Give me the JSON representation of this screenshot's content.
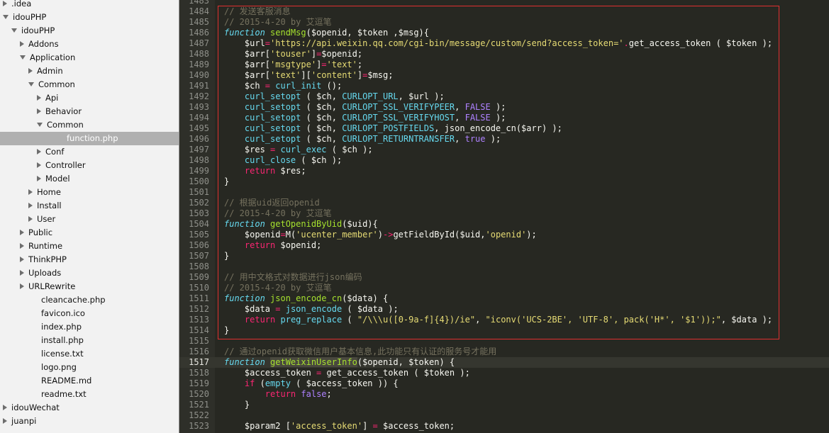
{
  "sidebar": {
    "items": [
      {
        "label": ".idea",
        "depth": 0,
        "state": "closed"
      },
      {
        "label": "idouPHP",
        "depth": 0,
        "state": "open"
      },
      {
        "label": "idouPHP",
        "depth": 1,
        "state": "open"
      },
      {
        "label": "Addons",
        "depth": 2,
        "state": "closed"
      },
      {
        "label": "Application",
        "depth": 2,
        "state": "open"
      },
      {
        "label": "Admin",
        "depth": 3,
        "state": "closed"
      },
      {
        "label": "Common",
        "depth": 3,
        "state": "open"
      },
      {
        "label": "Api",
        "depth": 4,
        "state": "closed"
      },
      {
        "label": "Behavior",
        "depth": 4,
        "state": "closed"
      },
      {
        "label": "Common",
        "depth": 4,
        "state": "open"
      },
      {
        "label": "function.php",
        "depth": 5,
        "state": "file",
        "selected": true
      },
      {
        "label": "Conf",
        "depth": 4,
        "state": "closed"
      },
      {
        "label": "Controller",
        "depth": 4,
        "state": "closed"
      },
      {
        "label": "Model",
        "depth": 4,
        "state": "closed"
      },
      {
        "label": "Home",
        "depth": 3,
        "state": "closed"
      },
      {
        "label": "Install",
        "depth": 3,
        "state": "closed"
      },
      {
        "label": "User",
        "depth": 3,
        "state": "closed"
      },
      {
        "label": "Public",
        "depth": 2,
        "state": "closed"
      },
      {
        "label": "Runtime",
        "depth": 2,
        "state": "closed"
      },
      {
        "label": "ThinkPHP",
        "depth": 2,
        "state": "closed"
      },
      {
        "label": "Uploads",
        "depth": 2,
        "state": "closed"
      },
      {
        "label": "URLRewrite",
        "depth": 2,
        "state": "closed"
      },
      {
        "label": "cleancache.php",
        "depth": 2,
        "state": "file"
      },
      {
        "label": "favicon.ico",
        "depth": 2,
        "state": "file"
      },
      {
        "label": "index.php",
        "depth": 2,
        "state": "file"
      },
      {
        "label": "install.php",
        "depth": 2,
        "state": "file"
      },
      {
        "label": "license.txt",
        "depth": 2,
        "state": "file"
      },
      {
        "label": "logo.png",
        "depth": 2,
        "state": "file"
      },
      {
        "label": "README.md",
        "depth": 2,
        "state": "file"
      },
      {
        "label": "readme.txt",
        "depth": 2,
        "state": "file"
      },
      {
        "label": "idouWechat",
        "depth": 0,
        "state": "closed"
      },
      {
        "label": "juanpi",
        "depth": 0,
        "state": "closed"
      }
    ]
  },
  "editor": {
    "current_line": 1517,
    "lines": [
      {
        "n": "1483",
        "tokens": []
      },
      {
        "n": "1484",
        "tokens": [
          [
            "c",
            "// 发送客服消息"
          ]
        ]
      },
      {
        "n": "1485",
        "tokens": [
          [
            "c",
            "// 2015-4-20 by 艾逗笔"
          ]
        ]
      },
      {
        "n": "1486",
        "tokens": [
          [
            "kw",
            "function"
          ],
          [
            "",
            " "
          ],
          [
            "f",
            "sendMsg"
          ],
          [
            "",
            "($openid, $token ,$msg){"
          ]
        ]
      },
      {
        "n": "1487",
        "tokens": [
          [
            "",
            "    $url"
          ],
          [
            "k",
            "="
          ],
          [
            "s",
            "'https://api.weixin.qq.com/cgi-bin/message/custom/send?access_token='"
          ],
          [
            "k",
            "."
          ],
          [
            "",
            "get_access_token ( $token );"
          ]
        ]
      },
      {
        "n": "1488",
        "tokens": [
          [
            "",
            "    $arr["
          ],
          [
            "s",
            "'touser'"
          ],
          [
            "",
            "]"
          ],
          [
            "k",
            "="
          ],
          [
            "",
            "$openid;"
          ]
        ]
      },
      {
        "n": "1489",
        "tokens": [
          [
            "",
            "    $arr["
          ],
          [
            "s",
            "'msgtype'"
          ],
          [
            "",
            "]"
          ],
          [
            "k",
            "="
          ],
          [
            "s",
            "'text'"
          ],
          [
            "",
            ";"
          ]
        ]
      },
      {
        "n": "1490",
        "tokens": [
          [
            "",
            "    $arr["
          ],
          [
            "s",
            "'text'"
          ],
          [
            "",
            "]["
          ],
          [
            "s",
            "'content'"
          ],
          [
            "",
            "]"
          ],
          [
            "k",
            "="
          ],
          [
            "",
            "$msg;"
          ]
        ]
      },
      {
        "n": "1491",
        "tokens": [
          [
            "",
            "    $ch "
          ],
          [
            "k",
            "="
          ],
          [
            "",
            " "
          ],
          [
            "b",
            "curl_init"
          ],
          [
            "",
            " ();"
          ]
        ]
      },
      {
        "n": "1492",
        "tokens": [
          [
            "",
            "    "
          ],
          [
            "b",
            "curl_setopt"
          ],
          [
            "",
            " ( $ch, "
          ],
          [
            "b",
            "CURLOPT_URL"
          ],
          [
            "",
            ", $url );"
          ]
        ]
      },
      {
        "n": "1493",
        "tokens": [
          [
            "",
            "    "
          ],
          [
            "b",
            "curl_setopt"
          ],
          [
            "",
            " ( $ch, "
          ],
          [
            "b",
            "CURLOPT_SSL_VERIFYPEER"
          ],
          [
            "",
            ", "
          ],
          [
            "cst",
            "FALSE"
          ],
          [
            "",
            " );"
          ]
        ]
      },
      {
        "n": "1494",
        "tokens": [
          [
            "",
            "    "
          ],
          [
            "b",
            "curl_setopt"
          ],
          [
            "",
            " ( $ch, "
          ],
          [
            "b",
            "CURLOPT_SSL_VERIFYHOST"
          ],
          [
            "",
            ", "
          ],
          [
            "cst",
            "FALSE"
          ],
          [
            "",
            " );"
          ]
        ]
      },
      {
        "n": "1495",
        "tokens": [
          [
            "",
            "    "
          ],
          [
            "b",
            "curl_setopt"
          ],
          [
            "",
            " ( $ch, "
          ],
          [
            "b",
            "CURLOPT_POSTFIELDS"
          ],
          [
            "",
            ", json_encode_cn($arr) );"
          ]
        ]
      },
      {
        "n": "1496",
        "tokens": [
          [
            "",
            "    "
          ],
          [
            "b",
            "curl_setopt"
          ],
          [
            "",
            " ( $ch, "
          ],
          [
            "b",
            "CURLOPT_RETURNTRANSFER"
          ],
          [
            "",
            ", "
          ],
          [
            "cst",
            "true"
          ],
          [
            "",
            " );"
          ]
        ]
      },
      {
        "n": "1497",
        "tokens": [
          [
            "",
            "    $res "
          ],
          [
            "k",
            "="
          ],
          [
            "",
            " "
          ],
          [
            "b",
            "curl_exec"
          ],
          [
            "",
            " ( $ch );"
          ]
        ]
      },
      {
        "n": "1498",
        "tokens": [
          [
            "",
            "    "
          ],
          [
            "b",
            "curl_close"
          ],
          [
            "",
            " ( $ch );"
          ]
        ]
      },
      {
        "n": "1499",
        "tokens": [
          [
            "",
            "    "
          ],
          [
            "k",
            "return"
          ],
          [
            "",
            " $res;"
          ]
        ]
      },
      {
        "n": "1500",
        "tokens": [
          [
            "",
            "}"
          ]
        ]
      },
      {
        "n": "1501",
        "tokens": []
      },
      {
        "n": "1502",
        "tokens": [
          [
            "c",
            "// 根据uid返回openid"
          ]
        ]
      },
      {
        "n": "1503",
        "tokens": [
          [
            "c",
            "// 2015-4-20 by 艾逗笔"
          ]
        ]
      },
      {
        "n": "1504",
        "tokens": [
          [
            "kw",
            "function"
          ],
          [
            "",
            " "
          ],
          [
            "f",
            "getOpenidByUid"
          ],
          [
            "",
            "($uid){"
          ]
        ]
      },
      {
        "n": "1505",
        "tokens": [
          [
            "",
            "    $openid"
          ],
          [
            "k",
            "="
          ],
          [
            "",
            "M("
          ],
          [
            "s",
            "'ucenter_member'"
          ],
          [
            "",
            ")"
          ],
          [
            "k",
            "->"
          ],
          [
            "",
            "getFieldById($uid,"
          ],
          [
            "s",
            "'openid'"
          ],
          [
            "",
            ");"
          ]
        ]
      },
      {
        "n": "1506",
        "tokens": [
          [
            "",
            "    "
          ],
          [
            "k",
            "return"
          ],
          [
            "",
            " $openid;"
          ]
        ]
      },
      {
        "n": "1507",
        "tokens": [
          [
            "",
            "}"
          ]
        ]
      },
      {
        "n": "1508",
        "tokens": []
      },
      {
        "n": "1509",
        "tokens": [
          [
            "c",
            "// 用中文格式对数据进行json编码"
          ]
        ]
      },
      {
        "n": "1510",
        "tokens": [
          [
            "c",
            "// 2015-4-20 by 艾逗笔"
          ]
        ]
      },
      {
        "n": "1511",
        "tokens": [
          [
            "kw",
            "function"
          ],
          [
            "",
            " "
          ],
          [
            "f",
            "json_encode_cn"
          ],
          [
            "",
            "($data) {"
          ]
        ]
      },
      {
        "n": "1512",
        "tokens": [
          [
            "",
            "    $data "
          ],
          [
            "k",
            "="
          ],
          [
            "",
            " "
          ],
          [
            "b",
            "json_encode"
          ],
          [
            "",
            " ( $data );"
          ]
        ]
      },
      {
        "n": "1513",
        "tokens": [
          [
            "",
            "    "
          ],
          [
            "k",
            "return"
          ],
          [
            "",
            " "
          ],
          [
            "b",
            "preg_replace"
          ],
          [
            "",
            " ( "
          ],
          [
            "s",
            "\"/\\\\\\u([0-9a-f]{4})/ie\""
          ],
          [
            "",
            ", "
          ],
          [
            "s",
            "\"iconv('UCS-2BE', 'UTF-8', pack('H*', '$1'));\""
          ],
          [
            "",
            ", $data );"
          ]
        ]
      },
      {
        "n": "1514",
        "tokens": [
          [
            "",
            "}"
          ]
        ]
      },
      {
        "n": "1515",
        "tokens": []
      },
      {
        "n": "1516",
        "tokens": [
          [
            "c",
            "// 通过openid获取微信用户基本信息,此功能只有认证的服务号才能用"
          ]
        ]
      },
      {
        "n": "1517",
        "tokens": [
          [
            "kw",
            "function"
          ],
          [
            "",
            " "
          ],
          [
            "f hl",
            "getWeixinUserInfo"
          ],
          [
            "",
            "($openid, $token) {"
          ]
        ]
      },
      {
        "n": "1518",
        "tokens": [
          [
            "",
            "    $access_token "
          ],
          [
            "k",
            "="
          ],
          [
            "",
            " get_access_token ( $token );"
          ]
        ]
      },
      {
        "n": "1519",
        "tokens": [
          [
            "",
            "    "
          ],
          [
            "k",
            "if"
          ],
          [
            "",
            " ("
          ],
          [
            "b",
            "empty"
          ],
          [
            "",
            " ( $access_token )) {"
          ]
        ]
      },
      {
        "n": "1520",
        "tokens": [
          [
            "",
            "        "
          ],
          [
            "k",
            "return"
          ],
          [
            "",
            " "
          ],
          [
            "cst",
            "false"
          ],
          [
            "",
            ";"
          ]
        ]
      },
      {
        "n": "1521",
        "tokens": [
          [
            "",
            "    }"
          ]
        ]
      },
      {
        "n": "1522",
        "tokens": []
      },
      {
        "n": "1523",
        "tokens": [
          [
            "",
            "    $param2 ["
          ],
          [
            "s",
            "'access_token'"
          ],
          [
            "",
            "] "
          ],
          [
            "k",
            "="
          ],
          [
            "",
            " $access_token;"
          ]
        ]
      }
    ]
  }
}
